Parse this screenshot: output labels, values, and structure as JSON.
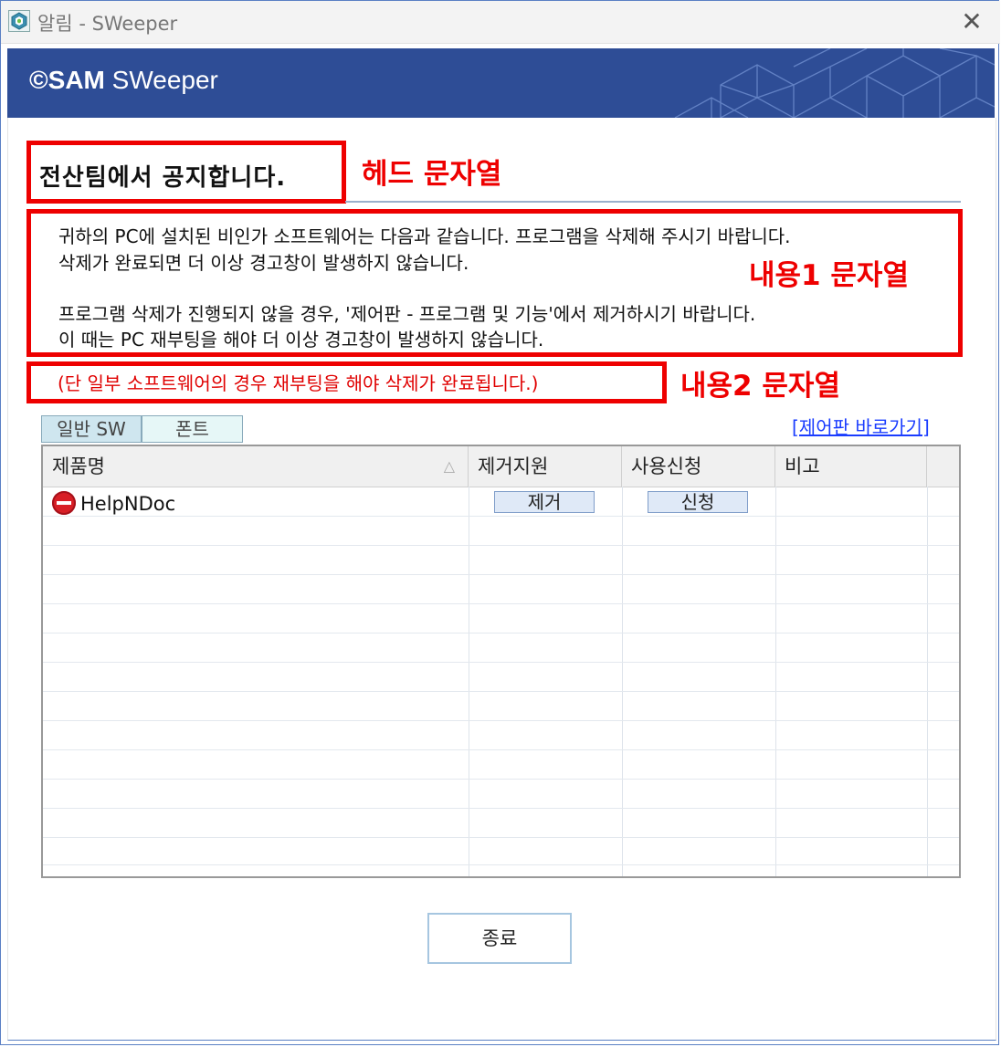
{
  "window": {
    "title": "알림 - SWeeper",
    "close_glyph": "✕"
  },
  "banner": {
    "logo_symbol": "©",
    "logo_brand": "SAM",
    "logo_product": "SWeeper",
    "background": "#2e4d96"
  },
  "notice": {
    "head": "전산팀에서 공지합니다.",
    "body_lines": [
      "귀하의 PC에 설치된 비인가 소프트웨어는 다음과 같습니다. 프로그램을 삭제해 주시기 바랍니다.",
      "삭제가 완료되면 더 이상 경고창이 발생하지 않습니다.",
      "프로그램 삭제가 진행되지 않을 경우, '제어판 - 프로그램 및 기능'에서 제거하시기 바랍니다.",
      "이 때는 PC 재부팅을 해야 더 이상 경고창이 발생하지 않습니다."
    ],
    "note": "(단 일부 소프트웨어의 경우 재부팅을 해야 삭제가 완료됩니다.)"
  },
  "annotations": {
    "head_label": "헤드 문자열",
    "body_label": "내용1 문자열",
    "note_label": "내용2 문자열",
    "color": "#ee0000"
  },
  "tabs": [
    {
      "label": "일반 SW",
      "selected": true
    },
    {
      "label": "폰트",
      "selected": false
    }
  ],
  "control_panel_link": "[제어판 바로가기]",
  "table": {
    "columns": [
      "제품명",
      "제거지원",
      "사용신청",
      "비고"
    ],
    "sort_indicator": "△",
    "rows": [
      {
        "name": "HelpNDoc",
        "status_icon": "stop-icon",
        "remove_label": "제거",
        "request_label": "신청",
        "note": ""
      }
    ]
  },
  "footer": {
    "close_label": "종료"
  }
}
